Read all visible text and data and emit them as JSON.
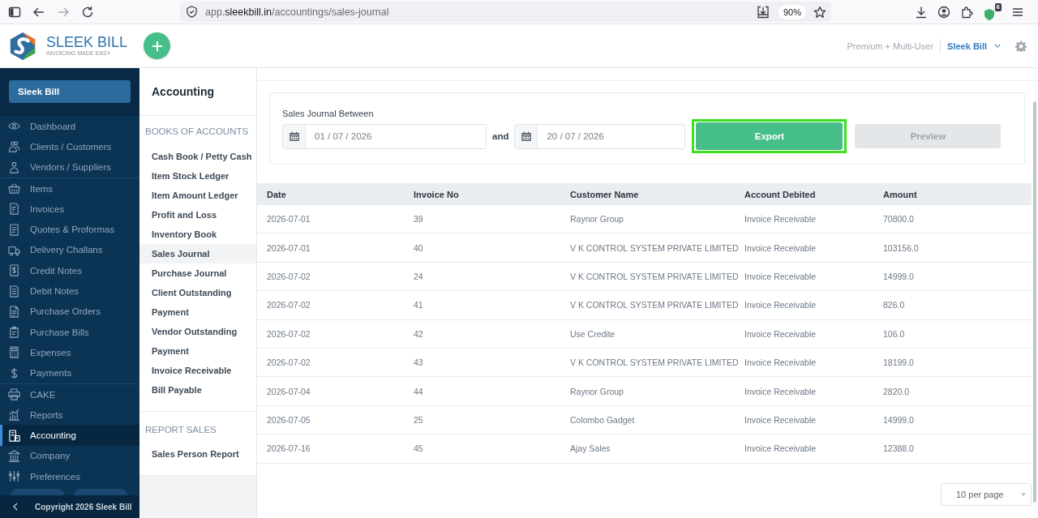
{
  "browser": {
    "url": "app.**sleekbill.in**/accountings/sales-journal",
    "zoom": "90%",
    "extension_badge": "6"
  },
  "header": {
    "logo": {
      "name": "SLEEK BILL",
      "tagline": "INVOICING MADE EASY"
    },
    "plan": "Premium + Multi-User",
    "account": "Sleek Bill"
  },
  "sidebar": {
    "company_button": "Sleek Bill",
    "sections": [
      {
        "items": [
          {
            "label": "Dashboard",
            "selected": false
          },
          {
            "label": "Clients / Customers",
            "selected": false
          },
          {
            "label": "Vendors / Suppliers",
            "selected": false
          }
        ]
      },
      {
        "items": [
          {
            "label": "Items",
            "selected": false
          },
          {
            "label": "Invoices",
            "selected": false
          },
          {
            "label": "Quotes & Proformas",
            "selected": false
          },
          {
            "label": "Delivery Challans",
            "selected": false
          },
          {
            "label": "Credit Notes",
            "selected": false
          },
          {
            "label": "Debit Notes",
            "selected": false
          },
          {
            "label": "Purchase Orders",
            "selected": false
          },
          {
            "label": "Purchase Bills",
            "selected": false
          },
          {
            "label": "Expenses",
            "selected": false
          },
          {
            "label": "Payments",
            "selected": false
          }
        ]
      },
      {
        "items": [
          {
            "label": "CAKE",
            "selected": false
          },
          {
            "label": "Reports",
            "selected": false
          },
          {
            "label": "Accounting",
            "selected": true
          },
          {
            "label": "Company",
            "selected": false
          },
          {
            "label": "Preferences",
            "selected": false
          }
        ]
      }
    ],
    "footer": "Copyright 2026 Sleek Bill"
  },
  "submenu": {
    "title": "Accounting",
    "sections": [
      {
        "heading": "BOOKS OF ACCOUNTS",
        "items": [
          {
            "label": "Cash Book / Petty Cash",
            "selected": false
          },
          {
            "label": "Item Stock Ledger",
            "selected": false
          },
          {
            "label": "Item Amount Ledger",
            "selected": false
          },
          {
            "label": "Profit and Loss",
            "selected": false
          },
          {
            "label": "Inventory Book",
            "selected": false
          },
          {
            "label": "Sales Journal",
            "selected": true
          },
          {
            "label": "Purchase Journal",
            "selected": false
          },
          {
            "label": "Client Outstanding",
            "selected": false
          },
          {
            "label": "Payment",
            "selected": false
          },
          {
            "label": "Vendor Outstanding",
            "selected": false
          },
          {
            "label": "Payment",
            "selected": false
          },
          {
            "label": "Invoice Receivable",
            "selected": false
          },
          {
            "label": "Bill Payable",
            "selected": false
          }
        ]
      },
      {
        "heading": "REPORT SALES",
        "items": [
          {
            "label": "Sales Person Report",
            "selected": false
          }
        ]
      }
    ]
  },
  "filter": {
    "label": "Sales Journal Between",
    "from_date": {
      "value": "01 / 07 / 2026"
    },
    "joiner": "and",
    "to_date": {
      "value": "20 / 07 / 2026"
    },
    "buttons": [
      {
        "label": "Export",
        "kind": "primary",
        "highlighted": true
      },
      {
        "label": "Preview",
        "kind": "secondary",
        "highlighted": false
      }
    ]
  },
  "table": {
    "columns": [
      "Date",
      "Invoice No",
      "Customer Name",
      "Account Debited",
      "Amount"
    ],
    "rows": [
      [
        "2026-07-01",
        "39",
        "Raynor Group",
        "Invoice Receivable",
        "70800.0"
      ],
      [
        "2026-07-01",
        "40",
        "V K CONTROL SYSTEM PRIVATE LIMITED",
        "Invoice Receivable",
        "103156.0"
      ],
      [
        "2026-07-02",
        "24",
        "V K CONTROL SYSTEM PRIVATE LIMITED",
        "Invoice Receivable",
        "14999.0"
      ],
      [
        "2026-07-02",
        "41",
        "V K CONTROL SYSTEM PRIVATE LIMITED",
        "Invoice Receivable",
        "826.0"
      ],
      [
        "2026-07-02",
        "42",
        "Use Credite",
        "Invoice Receivable",
        "106.0"
      ],
      [
        "2026-07-02",
        "43",
        "V K CONTROL SYSTEM PRIVATE LIMITED",
        "Invoice Receivable",
        "18199.0"
      ],
      [
        "2026-07-04",
        "44",
        "Raynor Group",
        "Invoice Receivable",
        "2820.0"
      ],
      [
        "2026-07-05",
        "25",
        "Colombo Gadget",
        "Invoice Receivable",
        "14999.0"
      ],
      [
        "2026-07-16",
        "45",
        "Ajay Sales",
        "Invoice Receivable",
        "12388.0"
      ]
    ]
  },
  "pagination": {
    "page_size": "10 per page"
  }
}
